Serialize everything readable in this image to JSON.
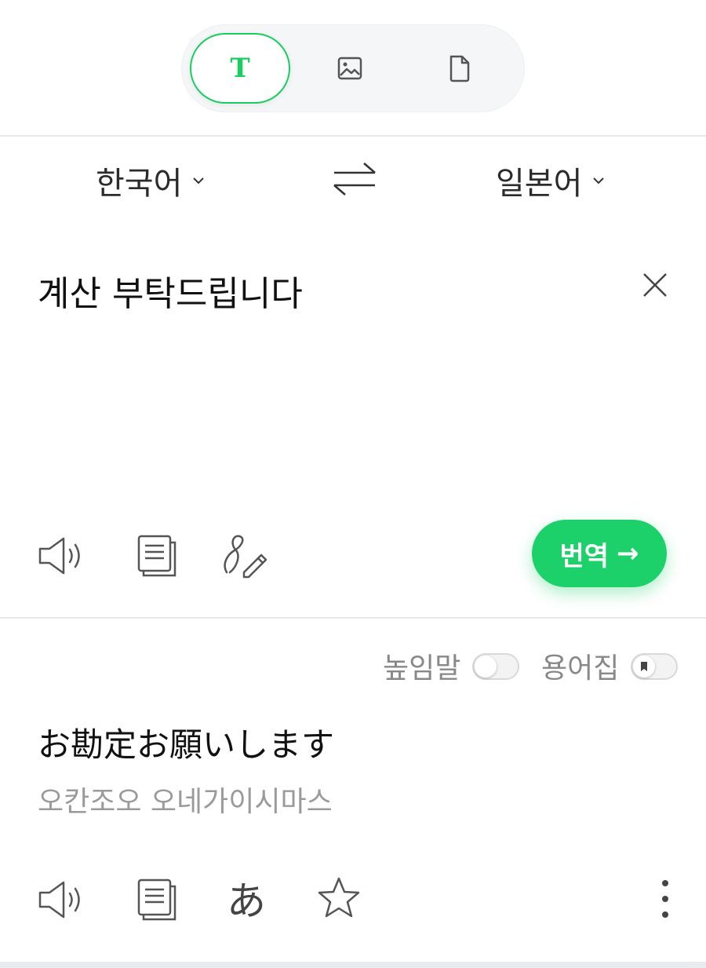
{
  "mode_tabs": [
    {
      "icon": "text-T-icon",
      "glyph": "T",
      "active": true
    },
    {
      "icon": "image-icon",
      "active": false
    },
    {
      "icon": "document-icon",
      "active": false
    }
  ],
  "languages": {
    "source": "한국어",
    "target": "일본어",
    "swap_icon": "swap-arrows-icon"
  },
  "source": {
    "text": "계산 부탁드립니다",
    "clear_icon": "close-icon",
    "tools": [
      "speaker-icon",
      "copy-icon",
      "handwriting-pen-icon"
    ],
    "translate_button": {
      "label": "번역",
      "arrow": "→"
    }
  },
  "result": {
    "honorific_toggle": {
      "label": "높임말",
      "on": false
    },
    "glossary_toggle": {
      "label": "용어집",
      "on": false
    },
    "text": "お勘定お願いします",
    "pronunciation": "오칸조오 오네가이시마스",
    "tools": [
      "speaker-icon",
      "copy-icon",
      "kana-icon",
      "star-icon",
      "more-vertical-icon"
    ],
    "kana_glyph": "あ"
  },
  "colors": {
    "accent": "#19ce60",
    "translate_button_bg": "#1dd16a",
    "muted_text": "#9a9a9a"
  }
}
